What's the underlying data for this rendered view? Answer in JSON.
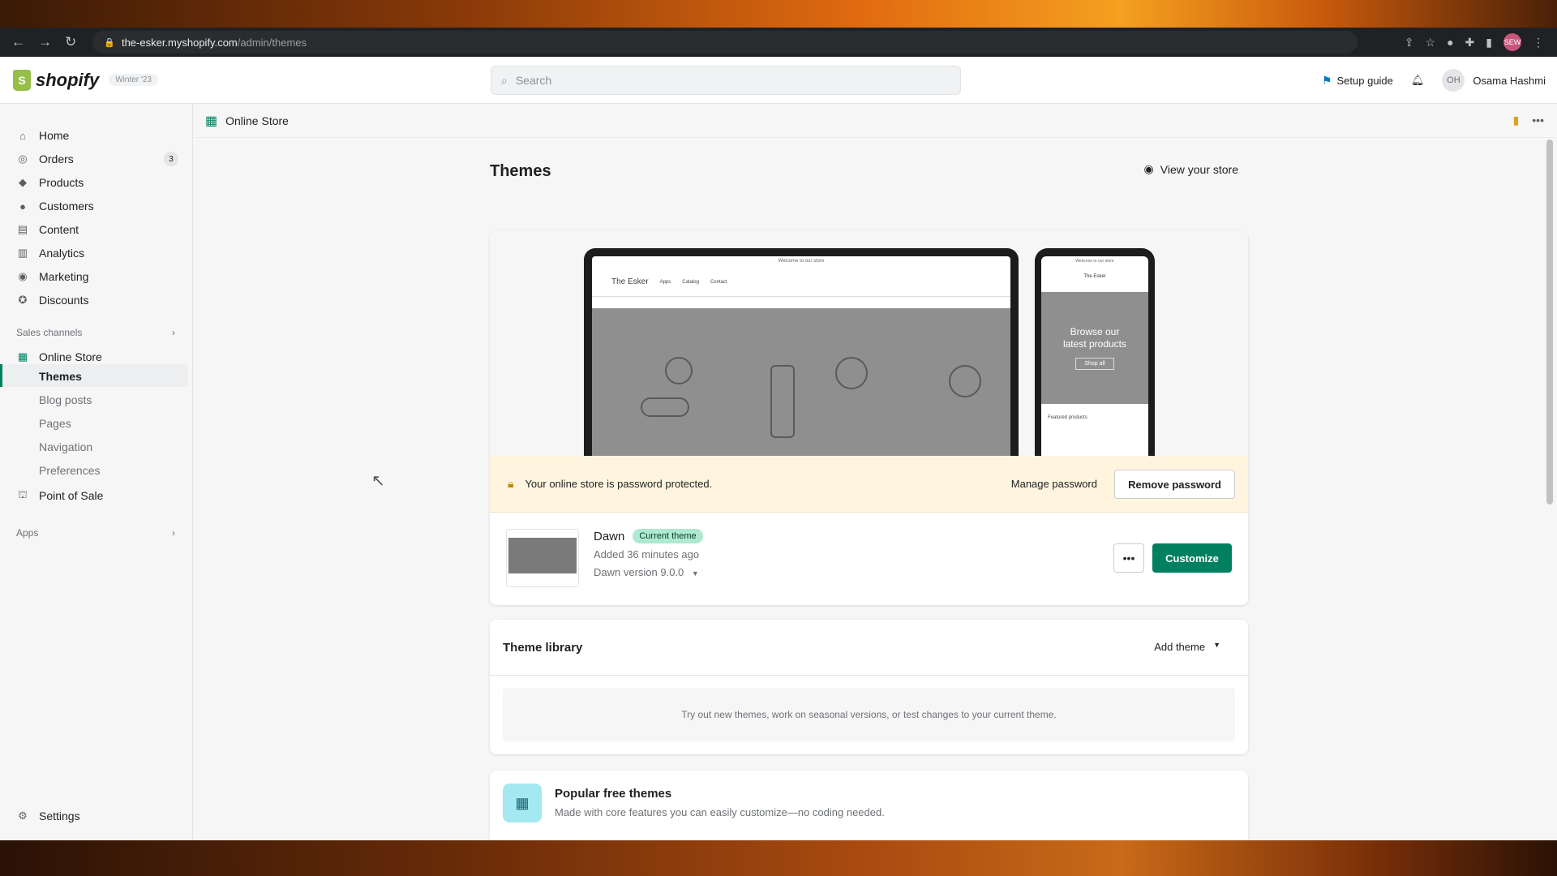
{
  "browser": {
    "url_host": "the-esker.myshopify.com",
    "url_path": "/admin/themes",
    "profile_initials": "SEW"
  },
  "topbar": {
    "logo_text": "shopify",
    "edition": "Winter '23",
    "search_placeholder": "Search",
    "setup_guide": "Setup guide",
    "user_initials": "OH",
    "user_name": "Osama Hashmi"
  },
  "sidebar": {
    "items": [
      {
        "label": "Home",
        "icon": "home-icon"
      },
      {
        "label": "Orders",
        "icon": "orders-icon",
        "badge": "3"
      },
      {
        "label": "Products",
        "icon": "tag-icon"
      },
      {
        "label": "Customers",
        "icon": "person-icon"
      },
      {
        "label": "Content",
        "icon": "content-icon"
      },
      {
        "label": "Analytics",
        "icon": "chart-icon"
      },
      {
        "label": "Marketing",
        "icon": "target-icon"
      },
      {
        "label": "Discounts",
        "icon": "discount-icon"
      }
    ],
    "sales_channels_label": "Sales channels",
    "online_store_label": "Online Store",
    "sub_items": [
      "Themes",
      "Blog posts",
      "Pages",
      "Navigation",
      "Preferences"
    ],
    "point_of_sale_label": "Point of Sale",
    "apps_label": "Apps",
    "settings_label": "Settings"
  },
  "page_header": {
    "breadcrumb": "Online Store"
  },
  "main": {
    "title": "Themes",
    "view_store": "View your store",
    "preview": {
      "laptop_store_name": "The Esker",
      "laptop_nav": [
        "Apps",
        "Catalog",
        "Contact"
      ],
      "laptop_announcement": "Welcome to our store",
      "phone_hero_text": "Browse our latest products",
      "phone_store_name": "The Esker",
      "phone_announcement": "Welcome to our store",
      "phone_button": "Shop all",
      "phone_section": "Featured products"
    },
    "password_banner": {
      "text": "Your online store is password protected.",
      "manage": "Manage password",
      "remove": "Remove password"
    },
    "current_theme": {
      "name": "Dawn",
      "badge": "Current theme",
      "added": "Added 36 minutes ago",
      "version": "Dawn version 9.0.0",
      "more": "•••",
      "customize": "Customize"
    },
    "library": {
      "title": "Theme library",
      "add_theme": "Add theme",
      "empty_text": "Try out new themes, work on seasonal versions, or test changes to your current theme."
    },
    "popular": {
      "title": "Popular free themes",
      "subtitle": "Made with core features you can easily customize—no coding needed."
    }
  },
  "colors": {
    "accent": "#008060",
    "banner_bg": "#fff5df",
    "badge_bg": "#aee9d1"
  }
}
